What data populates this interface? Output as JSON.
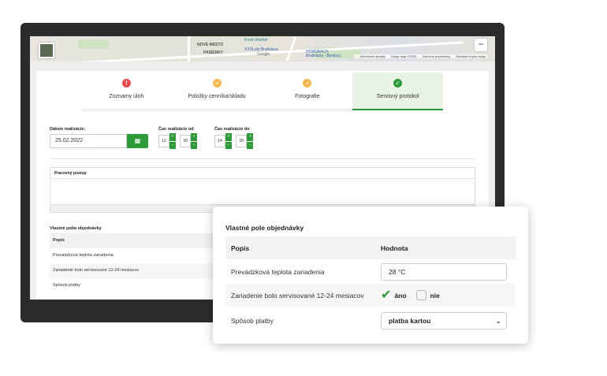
{
  "map": {
    "labels": {
      "nove_mesto": "NOVÉ MESTO",
      "pasienky": "PASIENKY",
      "fresh_market": "Fresh Market",
      "fotogr彩": "Fotografie",
      "xxxlutz": "XXXLutz Bratislava",
      "hornbach": "HORNBACH Bratislava - Bysirica"
    },
    "google": "Google",
    "footer": [
      "Klávesové skratky",
      "Údaje máp ©2022",
      "Zmluvné podmienky",
      "Nahlásiť chybu mapy"
    ],
    "zoom_label": "−"
  },
  "tabs": [
    {
      "label": "Zoznamy úloh",
      "icon": "!",
      "status": "red",
      "active": false
    },
    {
      "label": "Položky cenníka/skladu",
      "icon": "−",
      "status": "orange",
      "active": false
    },
    {
      "label": "Fotografie",
      "icon": "−",
      "status": "orange",
      "active": false
    },
    {
      "label": "Servisný protokol",
      "icon": "✓",
      "status": "green",
      "active": true
    }
  ],
  "form": {
    "date_label": "Dátum realizácie:",
    "date_value": "25.02.2022",
    "time_from_label": "Čas realizácie od",
    "time_from_h": "12",
    "time_from_m": "00",
    "time_to_label": "Čas realizácie do",
    "time_to_h": "14",
    "time_to_m": "00",
    "stepper_up": "+",
    "stepper_down": "−",
    "separator": ":",
    "calendar_icon": "▦"
  },
  "procedure": {
    "title": "Pracovný postup"
  },
  "custom_fields": {
    "title": "Vlastné polia objednávky",
    "header_col1": "Popis",
    "rows": [
      "Prevádzková teplota zariadenia",
      "Zariadenie bolo servisované 12-24 mesiacov",
      "Spôsob platby"
    ]
  },
  "popup": {
    "title": "Vlastné pole objednávky",
    "header_col1": "Popis",
    "header_col2": "Hodnota",
    "row1_label": "Prevádzková teplota zariadenia",
    "row1_value": "28 °C",
    "row2_label": "Zariadenie bolo servisované 12-24 mesiacov",
    "row2_yes": "áno",
    "row2_no": "nie",
    "row2_yes_checked": true,
    "row3_label": "Spôsob platby",
    "row3_value": "platba kartou",
    "check_icon": "✔",
    "chevron": "⌄"
  }
}
